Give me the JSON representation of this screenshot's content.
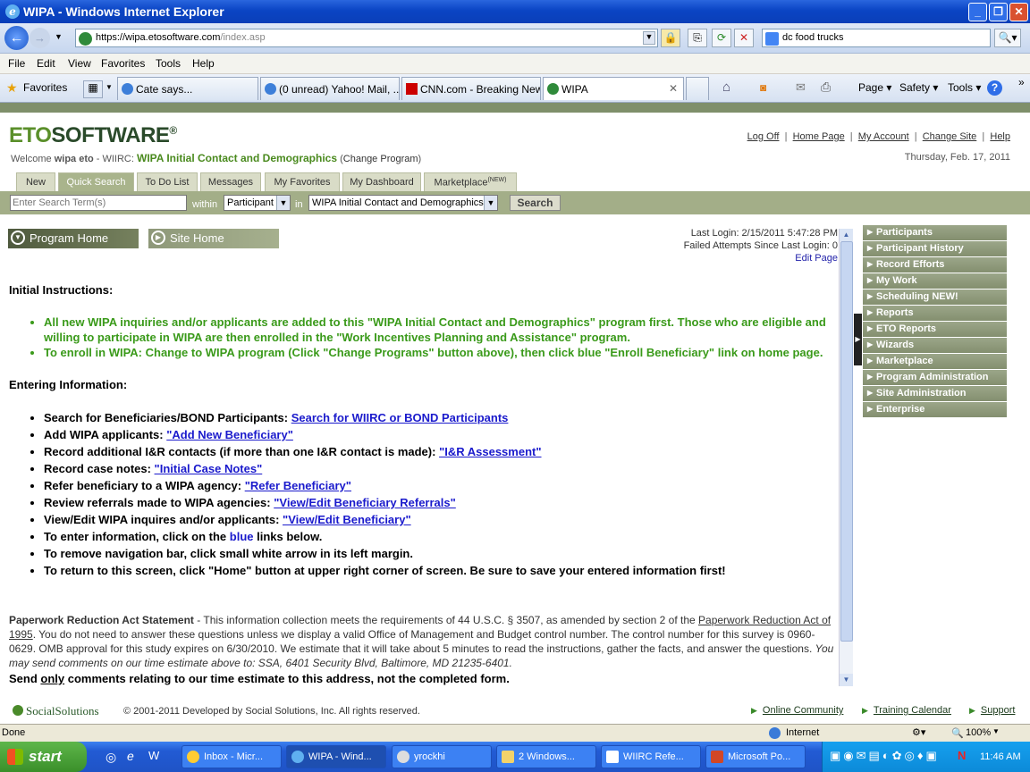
{
  "window": {
    "title": "WIPA - Windows Internet Explorer"
  },
  "address": {
    "protocol": "https://",
    "host": "wipa.etosoftware.com",
    "path": "/index.asp"
  },
  "search": {
    "value": "dc food trucks"
  },
  "menu": [
    "File",
    "Edit",
    "View",
    "Favorites",
    "Tools",
    "Help"
  ],
  "favbar": {
    "favorites_label": "Favorites"
  },
  "tabs": [
    {
      "label": "Cate says..."
    },
    {
      "label": "(0 unread) Yahoo! Mail, ..."
    },
    {
      "label": "CNN.com - Breaking New..."
    },
    {
      "label": "WIPA"
    }
  ],
  "commandbar": {
    "page": "Page ▾",
    "safety": "Safety ▾",
    "tools": "Tools ▾"
  },
  "eto": {
    "logo_eto": "ETO",
    "logo_software": "SOFTWARE",
    "logo_reg": "®",
    "welcome_prefix": "Welcome ",
    "welcome_user": "wipa eto",
    "welcome_sep": " - WIIRC: ",
    "program": "WIPA Initial Contact and Demographics",
    "change_program": "Change Program",
    "links": [
      "Log Off",
      "Home Page",
      "My Account",
      "Change Site",
      "Help"
    ],
    "date": "Thursday, Feb. 17, 2011",
    "tabs": [
      "New",
      "Quick Search",
      "To Do List",
      "Messages",
      "My Favorites",
      "My Dashboard",
      "Marketplace"
    ],
    "marketplace_sup": "(NEW)",
    "search_placeholder": "Enter Search Term(s)",
    "within_label": "within",
    "in_label": "in",
    "within_value": "Participant",
    "in_value": "WIPA Initial Contact and Demographics",
    "search_btn": "Search",
    "program_home": "Program Home",
    "site_home": "Site Home",
    "last_login": "Last Login: 2/15/2011 5:47:28 PM",
    "failed_attempts": "Failed Attempts Since Last Login: 0",
    "edit_page": "Edit Page"
  },
  "content": {
    "initial_heading": "Initial Instructions:",
    "initial_items": [
      "All new WIPA inquiries and/or applicants are added to this \"WIPA Initial Contact and Demographics\" program first.  Those who are eligible and willing to participate in WIPA are then enrolled in the \"Work Incentives Planning and Assistance\" program.",
      "To enroll in WIPA:  Change to WIPA program (Click \"Change Programs\" button above), then click blue \"Enroll Beneficiary\" link on home page."
    ],
    "entering_heading": "Entering Information:",
    "entering_items": [
      {
        "text": "Search for Beneficiaries/BOND Participants:  ",
        "link": "Search for WIIRC or BOND Participants"
      },
      {
        "text": "Add WIPA applicants:  ",
        "link": "\"Add New Beneficiary\""
      },
      {
        "text": "Record additional I&R contacts (if more than one I&R contact is made):  ",
        "link": "\"I&R Assessment\""
      },
      {
        "text": "Record case notes: ",
        "link": "\"Initial Case Notes\""
      },
      {
        "text": "Refer beneficiary to a WIPA agency:  ",
        "link": "\"Refer Beneficiary\""
      },
      {
        "text": "Review referrals made to WIPA agencies: ",
        "link": "\"View/Edit Beneficiary Referrals\""
      },
      {
        "text": "View/Edit WIPA inquires and/or applicants:  ",
        "link": "\"View/Edit Beneficiary\""
      }
    ],
    "enter_info_prefix": "To enter information, click on the ",
    "enter_info_blue": "blue",
    "enter_info_suffix": " links below.",
    "remove_nav": "To remove navigation bar, click small white arrow in its left margin.",
    "return_home": "To return to this screen, click \"Home\" button at upper right corner of screen.  Be sure to save your entered information first!",
    "paperwork_title": "Paperwork Reduction Act Statement",
    "paperwork_p1": " - This information collection meets the requirements of 44 U.S.C. § 3507, as amended by section 2 of the ",
    "paperwork_link": "Paperwork Reduction Act of 1995",
    "paperwork_p2": ".  You do not need to answer these questions unless we display a valid Office of Management and Budget control number.  The control number for this survey is 0960-0629.   OMB approval for this study expires on 6/30/2010. We estimate that it will take about 5 minutes to read the instructions, gather the facts, and answer the questions.  ",
    "paperwork_italic": "You may send comments on our time estimate above to:  SSA, 6401 Security Blvd, Baltimore, MD  21235-6401.",
    "send_prefix": "Send ",
    "send_only": "only",
    "send_suffix": " comments relating to our time estimate to this address, not the completed form."
  },
  "sidemenu": [
    "Participants",
    "Participant History",
    "Record Efforts",
    "My Work",
    "Scheduling NEW!",
    "Reports",
    "ETO Reports",
    "Wizards",
    "Marketplace",
    "Program Administration",
    "Site Administration",
    "Enterprise"
  ],
  "footer": {
    "brand": "SocialSolutions",
    "copyright": "© 2001-2011 Developed by Social Solutions, Inc. All rights reserved.",
    "links": [
      "Online Community",
      "Training Calendar",
      "Support"
    ]
  },
  "status": {
    "text": "Done",
    "zone": "Internet",
    "zoom": "100%"
  },
  "taskbar": {
    "start": "start",
    "items": [
      "Inbox - Micr...",
      "WIPA - Wind...",
      "yrockhi",
      "2 Windows...",
      "WIIRC Refe...",
      "Microsoft Po..."
    ],
    "time": "11:46 AM"
  }
}
